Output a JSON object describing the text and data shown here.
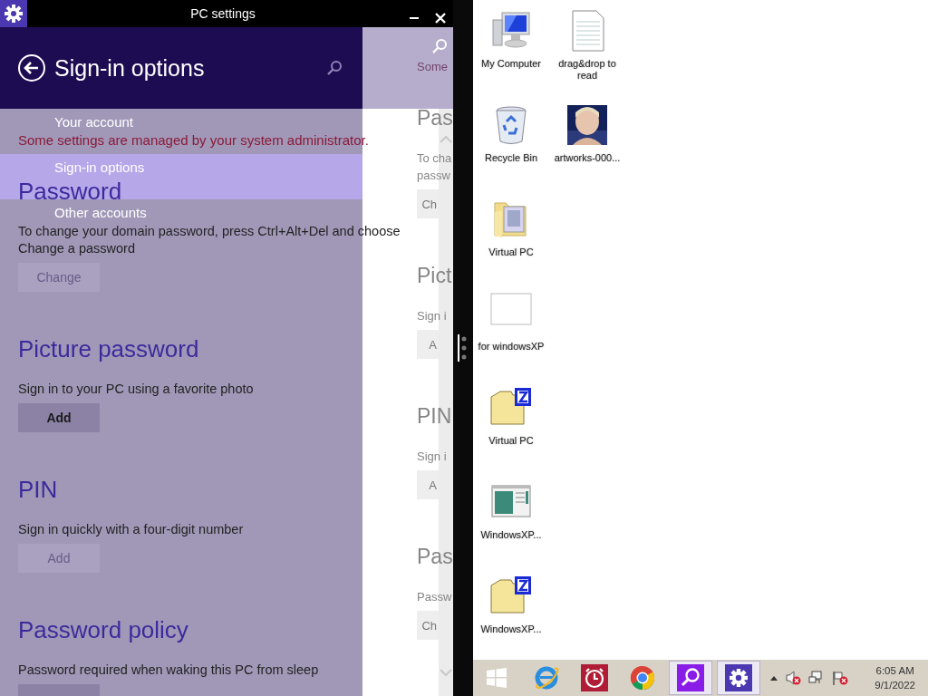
{
  "window": {
    "title": "PC settings"
  },
  "header": {
    "title": "Sign-in options"
  },
  "nav": {
    "items": [
      {
        "label": "Your account",
        "selected": false
      },
      {
        "label": "Sign-in options",
        "selected": true
      },
      {
        "label": "Other accounts",
        "selected": false
      }
    ]
  },
  "notice": "Some settings are managed by your system administrator.",
  "sections": [
    {
      "heading": "Password",
      "description": "To change your domain password, press Ctrl+Alt+Del and choose Change a password",
      "button": {
        "label": "Change",
        "disabled": true
      }
    },
    {
      "heading": "Picture password",
      "description": "Sign in to your PC using a favorite photo",
      "button": {
        "label": "Add",
        "disabled": false
      }
    },
    {
      "heading": "PIN",
      "description": "Sign in quickly with a four-digit number",
      "button": {
        "label": "Add",
        "disabled": true
      }
    },
    {
      "heading": "Password policy",
      "description": "Password required when waking this PC from sleep",
      "button": {
        "disabled": false
      }
    }
  ],
  "second_page": {
    "notice": "Some",
    "sections": [
      {
        "heading": "Pas",
        "lines": [
          "To cha",
          "passw"
        ],
        "button": "Ch"
      },
      {
        "heading": "Pict",
        "lines": [
          "Sign i"
        ],
        "button": "A"
      },
      {
        "heading": "PIN",
        "lines": [
          "Sign i"
        ],
        "button": "A"
      },
      {
        "heading": "Pas",
        "lines": [
          "Passw"
        ],
        "button": "Ch"
      }
    ]
  },
  "desktop": {
    "icons": [
      {
        "kind": "computer",
        "label": "My Computer"
      },
      {
        "kind": "recycle-bin",
        "label": "Recycle Bin"
      },
      {
        "kind": "photo-folder",
        "label": "Virtual PC"
      },
      {
        "kind": "blank-file",
        "label": "for windowsXP"
      },
      {
        "kind": "zip-folder",
        "label": "Virtual PC"
      },
      {
        "kind": "window",
        "label": "WindowsXP..."
      },
      {
        "kind": "zip-folder",
        "label": "WindowsXP..."
      },
      {
        "kind": "text-file",
        "label": "drag&drop to read"
      },
      {
        "kind": "picture",
        "label": "artworks-000..."
      }
    ]
  },
  "taskbar": {
    "buttons": [
      {
        "kind": "start",
        "active": false
      },
      {
        "kind": "ie",
        "active": false
      },
      {
        "kind": "alarm",
        "active": false
      },
      {
        "kind": "chrome",
        "active": false
      },
      {
        "kind": "search",
        "active": true
      },
      {
        "kind": "settings",
        "active": true
      }
    ],
    "tray": [
      {
        "kind": "caret"
      },
      {
        "kind": "speaker-muted"
      },
      {
        "kind": "network"
      },
      {
        "kind": "flag"
      }
    ],
    "time": "6:05 AM",
    "date": "9/1/2022"
  }
}
